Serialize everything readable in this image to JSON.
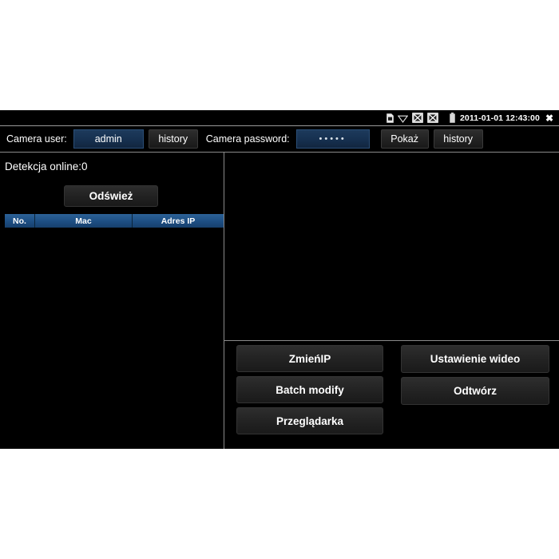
{
  "status_bar": {
    "icons": [
      {
        "name": "sim-card-icon",
        "glyph": "sim"
      },
      {
        "name": "wifi-signal-icon",
        "glyph": "wifi"
      },
      {
        "name": "network-disconnected-icon-1",
        "glyph": "net-x"
      },
      {
        "name": "network-disconnected-icon-2",
        "glyph": "net-x"
      },
      {
        "name": "battery-icon",
        "glyph": "battery"
      }
    ],
    "datetime": "2011-01-01 12:43:00",
    "close_label": "✖"
  },
  "credentials": {
    "user_label": "Camera user:",
    "user_value": "admin",
    "user_placeholder": "admin",
    "user_history_label": "history",
    "password_label": "Camera password:",
    "password_value": "•••••",
    "password_show_label": "Pokaż",
    "password_history_label": "history"
  },
  "left_panel": {
    "detection_status": "Detekcja online:0",
    "refresh_label": "Odśwież",
    "table": {
      "columns": [
        "No.",
        "Mac",
        "Adres IP"
      ],
      "rows": []
    }
  },
  "right_panel": {
    "actions_left": [
      "ZmieńIP",
      "Batch modify",
      "Przeglądarka"
    ],
    "actions_right": [
      "Ustawienie wideo",
      "Odtwórz"
    ]
  },
  "colors": {
    "background": "#000000",
    "page_background": "#ffffff",
    "field_blue": "#1a3554",
    "table_header_blue": "#1e5085",
    "divider": "#8a8a8a",
    "text": "#ffffff"
  }
}
